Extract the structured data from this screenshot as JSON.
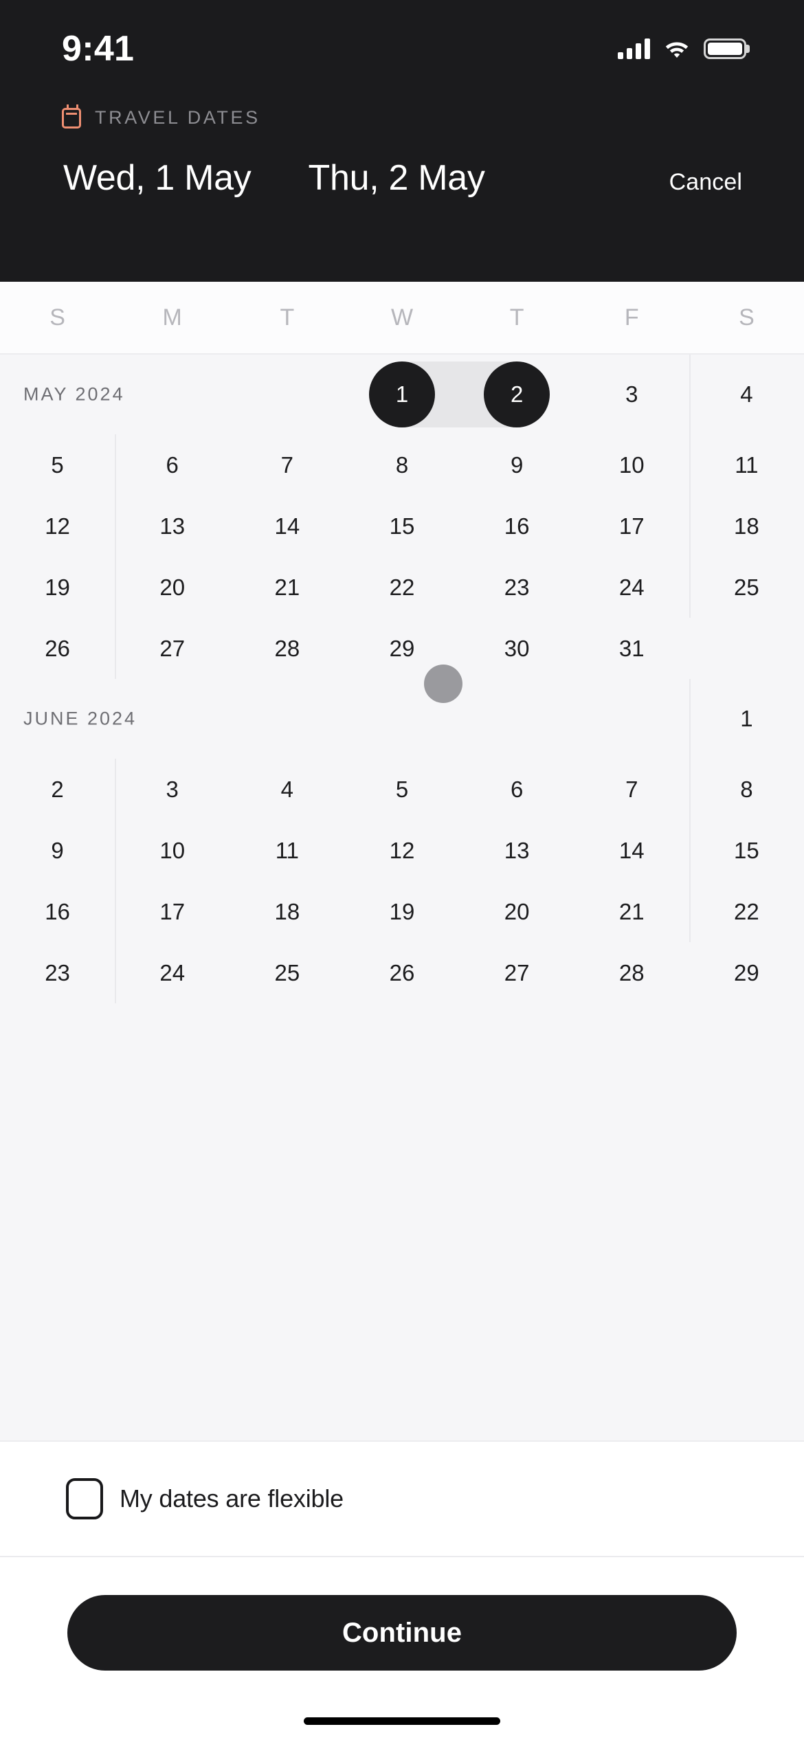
{
  "status_bar": {
    "time": "9:41",
    "cellular_icon": "signal-bars-icon",
    "wifi_icon": "wifi-icon",
    "battery_icon": "battery-icon"
  },
  "header": {
    "eyebrow_icon": "calendar-icon",
    "eyebrow_label": "TRAVEL DATES",
    "start_date": "Wed, 1 May",
    "end_date": "Thu, 2 May",
    "cancel_label": "Cancel",
    "background_color": "#1b1b1d",
    "accent_color": "#ef8f72"
  },
  "weekdays": [
    "S",
    "M",
    "T",
    "W",
    "T",
    "F",
    "S"
  ],
  "calendar": {
    "selection_color": "#1c1c1e",
    "range_band_color": "#e6e6e8",
    "touch_indicator_color": "#9a9a9e",
    "months": [
      {
        "label": "MAY 2024",
        "weeks": [
          [
            "",
            "",
            "",
            "1",
            "2",
            "3",
            "4"
          ],
          [
            "5",
            "6",
            "7",
            "8",
            "9",
            "10",
            "11"
          ],
          [
            "12",
            "13",
            "14",
            "15",
            "16",
            "17",
            "18"
          ],
          [
            "19",
            "20",
            "21",
            "22",
            "23",
            "24",
            "25"
          ],
          [
            "26",
            "27",
            "28",
            "29",
            "30",
            "31",
            ""
          ]
        ]
      },
      {
        "label": "JUNE 2024",
        "weeks": [
          [
            "",
            "",
            "",
            "",
            "",
            "",
            "1"
          ],
          [
            "2",
            "3",
            "4",
            "5",
            "6",
            "7",
            "8"
          ],
          [
            "9",
            "10",
            "11",
            "12",
            "13",
            "14",
            "15"
          ],
          [
            "16",
            "17",
            "18",
            "19",
            "20",
            "21",
            "22"
          ],
          [
            "23",
            "24",
            "25",
            "26",
            "27",
            "28",
            "29"
          ]
        ]
      }
    ],
    "selected_start": "1",
    "selected_end": "2"
  },
  "flexible": {
    "checkbox_checked": false,
    "label": "My dates are flexible"
  },
  "footer": {
    "continue_label": "Continue"
  }
}
